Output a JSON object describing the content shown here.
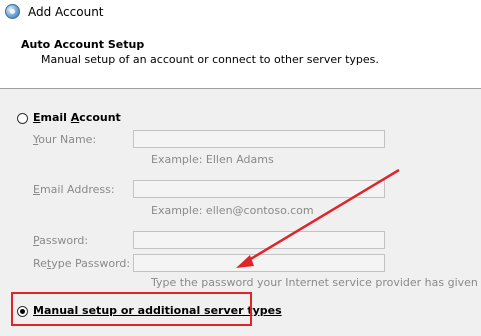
{
  "window": {
    "title": "Add Account",
    "icon": "outlook-globe-icon"
  },
  "header": {
    "title": "Auto Account Setup",
    "subtitle": "Manual setup of an account or connect to other server types."
  },
  "email_account": {
    "label_access": "E",
    "label_rest": "mail ",
    "label_access2": "A",
    "label_rest2": "ccount",
    "selected": false,
    "fields": {
      "your_name": {
        "label_access": "Y",
        "label_rest": "our Name:",
        "value": "",
        "example": "Example: Ellen Adams"
      },
      "email_address": {
        "label_access": "E",
        "label_rest": "mail Address:",
        "value": "",
        "example": "Example: ellen@contoso.com"
      },
      "password": {
        "label_access": "P",
        "label_rest": "assword:",
        "value": ""
      },
      "retype_password": {
        "label_pre": "Re",
        "label_access": "t",
        "label_rest": "ype Password:",
        "value": "",
        "hint": "Type the password your Internet service provider has given you."
      }
    }
  },
  "manual_setup": {
    "label": "Manual setup or additional server types",
    "selected": true
  },
  "annotation": {
    "arrow_color": "#e0242c",
    "box_color": "#e0242c"
  }
}
